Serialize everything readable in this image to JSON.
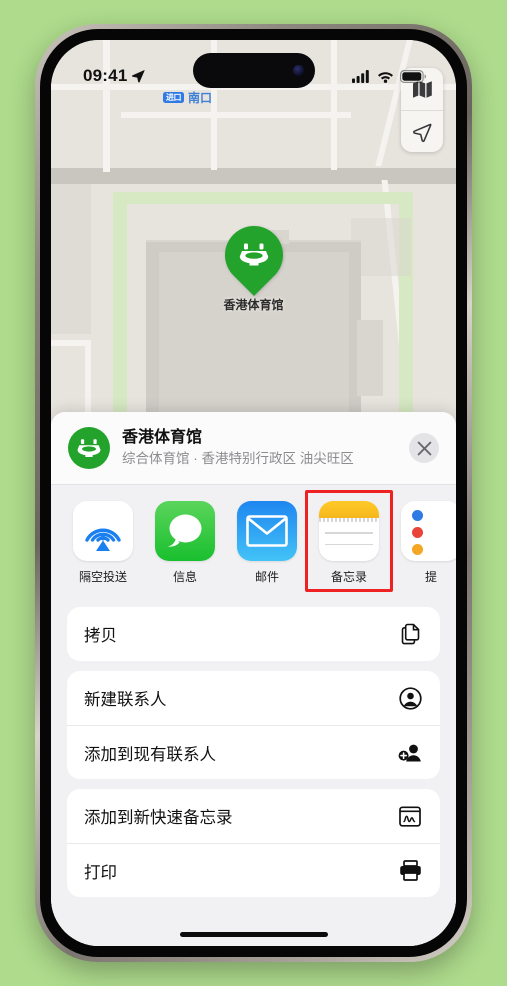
{
  "status_bar": {
    "time": "09:41",
    "location_icon": "location-arrow-icon",
    "cellular_icon": "cellular-signal-icon",
    "wifi_icon": "wifi-icon",
    "battery_icon": "battery-icon"
  },
  "map": {
    "label": {
      "badge": "进口",
      "text": "南口"
    },
    "pin": {
      "label": "香港体育馆",
      "icon": "stadium-icon",
      "color": "#23a32b"
    },
    "controls": [
      {
        "name": "map-mode-button",
        "icon": "folded-map-icon"
      },
      {
        "name": "user-location-button",
        "icon": "location-arrow-icon"
      }
    ],
    "background_color": "#e7e4de"
  },
  "share_sheet": {
    "header": {
      "title": "香港体育馆",
      "subtitle": "综合体育馆 · 香港特别行政区 油尖旺区",
      "avatar_icon": "stadium-icon",
      "close_icon": "close-icon"
    },
    "apps": [
      {
        "label": "隔空投送",
        "icon": "airdrop-icon",
        "highlighted": false
      },
      {
        "label": "信息",
        "icon": "messages-icon",
        "highlighted": false
      },
      {
        "label": "邮件",
        "icon": "mail-icon",
        "highlighted": false
      },
      {
        "label": "备忘录",
        "icon": "notes-icon",
        "highlighted": true
      },
      {
        "label": "提",
        "icon": "reminders-icon",
        "highlighted": false
      }
    ],
    "actions": [
      {
        "label": "拷贝",
        "icon": "copy-icon"
      },
      {
        "label": "新建联系人",
        "icon": "person-circle-icon"
      },
      {
        "label": "添加到现有联系人",
        "icon": "person-add-icon"
      },
      {
        "label": "添加到新快速备忘录",
        "icon": "quick-note-icon"
      },
      {
        "label": "打印",
        "icon": "printer-icon"
      }
    ]
  },
  "colors": {
    "page_background": "#aedb8c",
    "accent_green": "#23a32b",
    "highlight_red": "#ee2222"
  }
}
